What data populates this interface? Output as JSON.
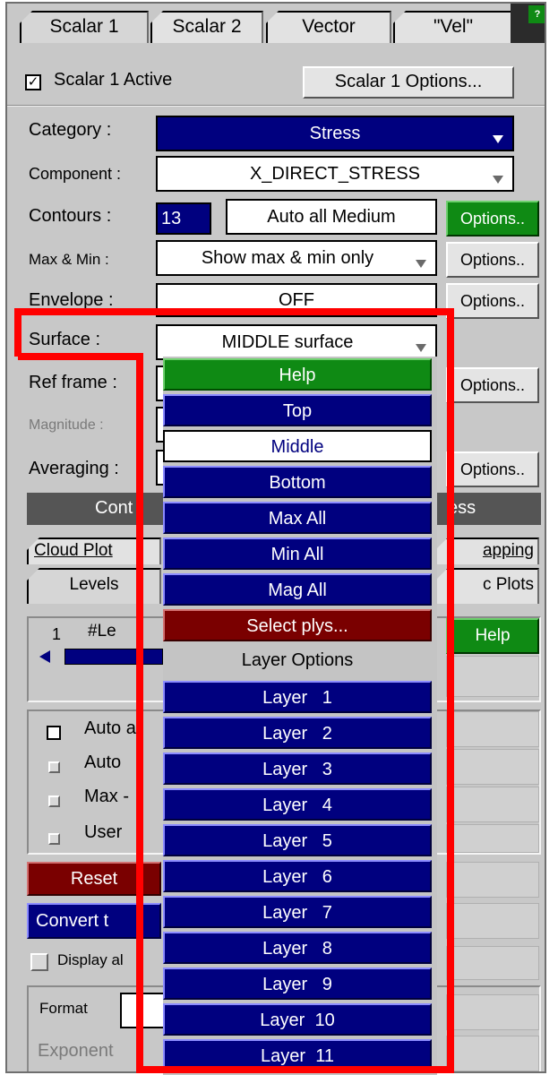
{
  "tabs": [
    "Scalar 1",
    "Scalar 2",
    "Vector",
    "\"Vel\""
  ],
  "help_badge": "?",
  "active_checkbox": {
    "checked": true,
    "mark": "✓",
    "label": "Scalar 1 Active"
  },
  "options_button": "Scalar 1 Options...",
  "category": {
    "label": "Category :",
    "value": "Stress"
  },
  "component": {
    "label": "Component :",
    "value": "X_DIRECT_STRESS"
  },
  "contours": {
    "label": "Contours :",
    "count": "13",
    "mode": "Auto all Medium",
    "options": "Options.."
  },
  "max_min": {
    "label": "Max & Min :",
    "value": "Show max & min only",
    "options": "Options.."
  },
  "envelope": {
    "label": "Envelope :",
    "value": "OFF",
    "options": "Options.."
  },
  "surface": {
    "label": "Surface :",
    "value": "MIDDLE surface"
  },
  "ref_frame": {
    "label": "Ref frame :",
    "options": "Options.."
  },
  "magnitude": {
    "label": "Magnitude :"
  },
  "averaging": {
    "label": "Averaging :",
    "options": "Options.."
  },
  "contour_bar": {
    "left": "Cont",
    "right": "ess"
  },
  "cloud_row": {
    "left": "Cloud Plot",
    "right": "apping"
  },
  "levels_row": {
    "left": "Levels",
    "right": "c Plots"
  },
  "levels_box": {
    "num": "1",
    "hash": "#Le",
    "help": "Help"
  },
  "checks": [
    {
      "label": "Auto a",
      "kind": "check"
    },
    {
      "label": "Auto",
      "kind": "radio"
    },
    {
      "label": "Max -",
      "kind": "radio"
    },
    {
      "label": "User",
      "kind": "radio"
    }
  ],
  "reset": "Reset",
  "convert": "Convert t",
  "display_all": "Display al",
  "format": {
    "label": "Format"
  },
  "exponent": "Exponent",
  "dropdown_items": [
    {
      "label": "Help",
      "style": "green"
    },
    {
      "label": "Top",
      "style": "nav"
    },
    {
      "label": "Middle",
      "style": "sel"
    },
    {
      "label": "Bottom",
      "style": "nav"
    },
    {
      "label": "Max All",
      "style": "nav"
    },
    {
      "label": "Min All",
      "style": "nav"
    },
    {
      "label": "Mag All",
      "style": "nav"
    },
    {
      "label": "Select plys...",
      "style": "maroon"
    },
    {
      "label": "Layer Options",
      "style": "plain"
    },
    {
      "label": "Layer   1",
      "style": "nav"
    },
    {
      "label": "Layer   2",
      "style": "nav"
    },
    {
      "label": "Layer   3",
      "style": "nav"
    },
    {
      "label": "Layer   4",
      "style": "nav"
    },
    {
      "label": "Layer   5",
      "style": "nav"
    },
    {
      "label": "Layer   6",
      "style": "nav"
    },
    {
      "label": "Layer   7",
      "style": "nav"
    },
    {
      "label": "Layer   8",
      "style": "nav"
    },
    {
      "label": "Layer   9",
      "style": "nav"
    },
    {
      "label": "Layer  10",
      "style": "nav"
    },
    {
      "label": "Layer  11",
      "style": "nav"
    }
  ],
  "colors": {
    "navy": "#00007f",
    "green": "#0f8a14",
    "maroon": "#7a0000",
    "panel": "#c8c8c8",
    "highlight": "#ff0000"
  }
}
